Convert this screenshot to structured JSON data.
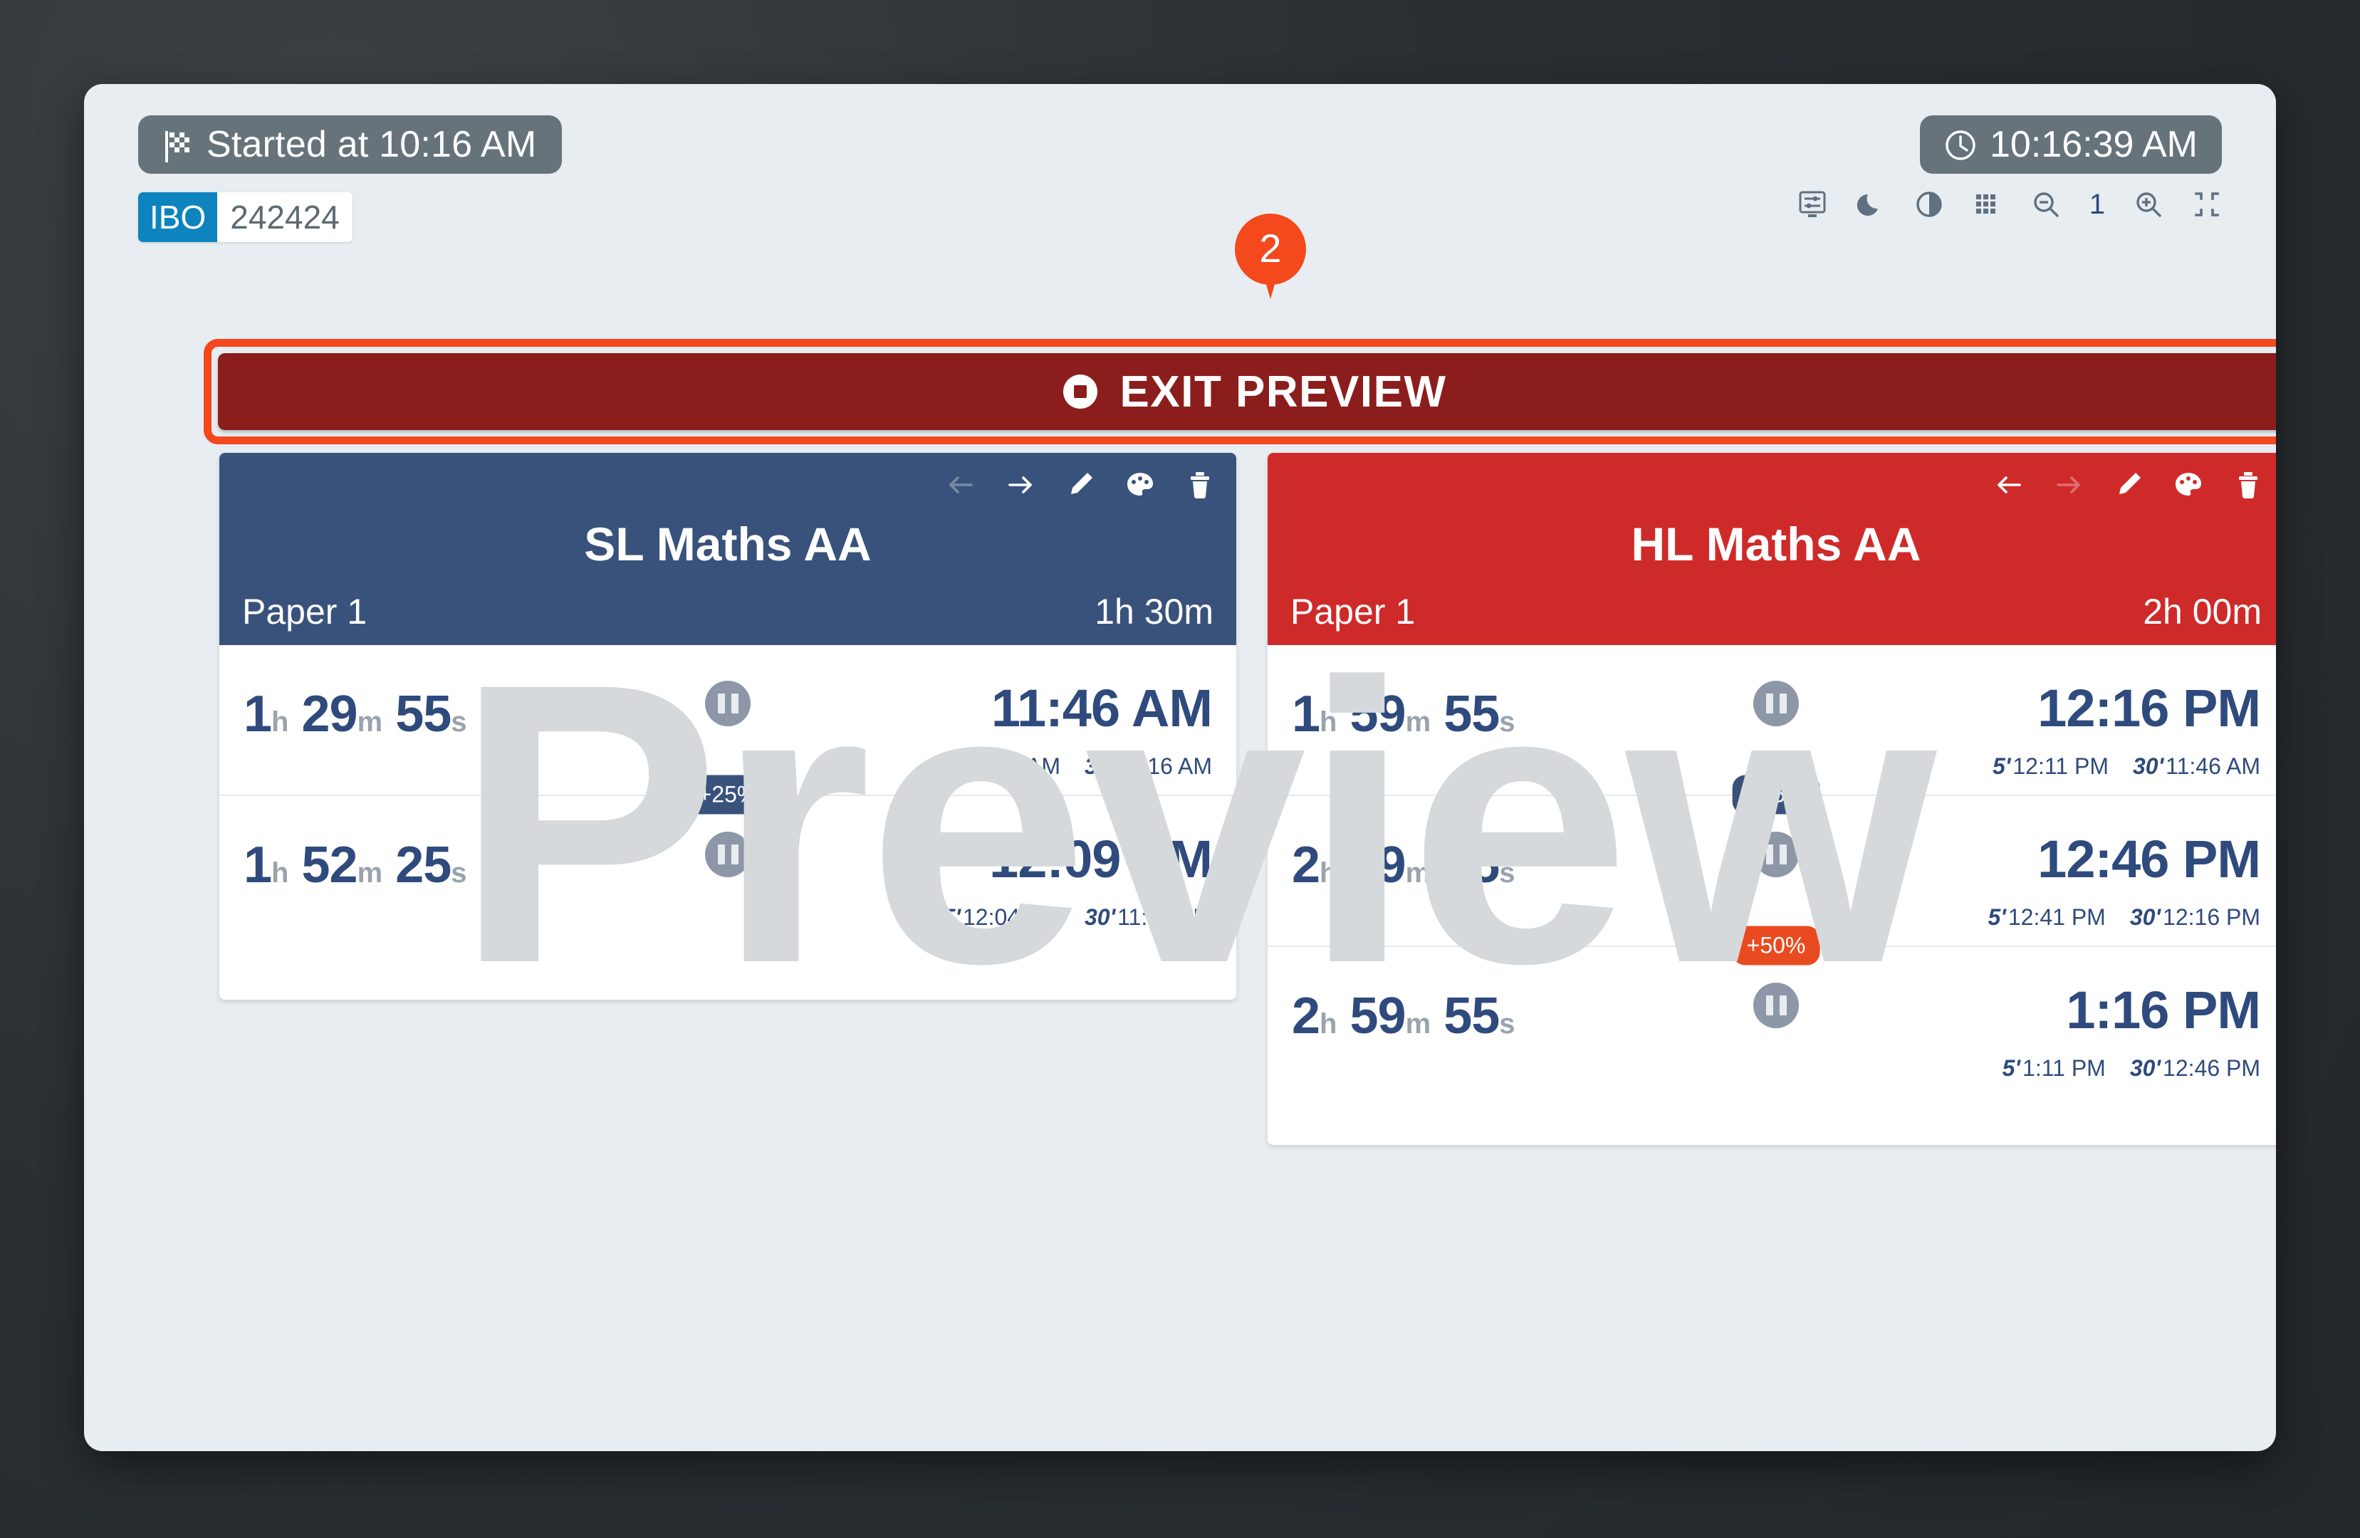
{
  "topbar": {
    "started_label": "Started at 10:16 AM",
    "started_icon": "checkered-flag-icon",
    "clock_time": "10:16:39 AM",
    "clock_icon": "clock-icon",
    "id_badge": {
      "prefix": "IBO",
      "value": "242424"
    },
    "tool_icons": [
      "display-settings-icon",
      "moon-icon",
      "contrast-icon",
      "grid-icon",
      "zoom-out-icon",
      "zoom-in-icon",
      "compress-icon"
    ],
    "zoom_level": "1"
  },
  "exit_preview": {
    "label": "EXIT PREVIEW",
    "icon": "stop-icon",
    "highlight_color": "#f4481d",
    "button_color": "#8b1e1c"
  },
  "marker": {
    "number": "2",
    "color": "#f4481d"
  },
  "watermark": "Preview",
  "cards": [
    {
      "title": "SL Maths AA",
      "paper": "Paper 1",
      "duration": "1h 30m",
      "accent": "#39527c",
      "head_icons": [
        "arrow-left-icon",
        "arrow-right-icon",
        "pencil-icon",
        "palette-icon",
        "trash-icon"
      ],
      "rows": [
        {
          "remaining": {
            "h": "1",
            "m": "29",
            "s": "55"
          },
          "end_time": "11:46 AM",
          "warn_5": "11:41 AM",
          "warn_30": "11:16 AM"
        },
        {
          "remaining": {
            "h": "1",
            "m": "52",
            "s": "25"
          },
          "end_time": "12:09 PM",
          "warn_5": "12:04 PM",
          "warn_30": "11:39 AM"
        }
      ],
      "dividers": [
        {
          "label": "+25%",
          "style": "blue"
        }
      ]
    },
    {
      "title": "HL Maths AA",
      "paper": "Paper 1",
      "duration": "2h 00m",
      "accent": "#cf2a2a",
      "head_icons": [
        "arrow-left-icon",
        "arrow-right-icon",
        "pencil-icon",
        "palette-icon",
        "trash-icon"
      ],
      "rows": [
        {
          "remaining": {
            "h": "1",
            "m": "59",
            "s": "55"
          },
          "end_time": "12:16 PM",
          "warn_5": "12:11 PM",
          "warn_30": "11:46 AM"
        },
        {
          "remaining": {
            "h": "2",
            "m": "29",
            "s": "55"
          },
          "end_time": "12:46 PM",
          "warn_5": "12:41 PM",
          "warn_30": "12:16 PM"
        },
        {
          "remaining": {
            "h": "2",
            "m": "59",
            "s": "55"
          },
          "end_time": "1:16 PM",
          "warn_5": "1:11 PM",
          "warn_30": "12:46 PM"
        }
      ],
      "dividers": [
        {
          "label": "+25%",
          "style": "blue"
        },
        {
          "label": "+50%",
          "style": "orange"
        }
      ]
    }
  ],
  "units": {
    "h": "h",
    "m": "m",
    "s": "s",
    "warn_5": "5'",
    "warn_30": "30'"
  }
}
